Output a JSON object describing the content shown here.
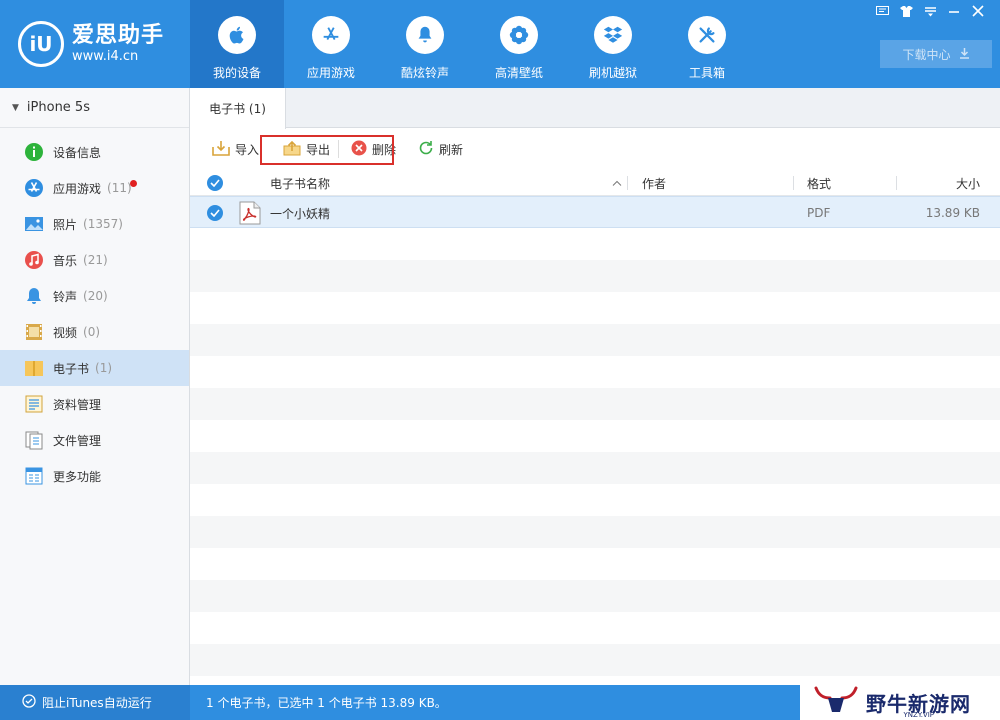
{
  "app": {
    "logo_main": "爱思助手",
    "logo_url": "www.i4.cn",
    "logo_mark": "iU"
  },
  "nav": [
    {
      "label": "我的设备",
      "icon": "apple-icon",
      "active": true
    },
    {
      "label": "应用游戏",
      "icon": "app-store-icon"
    },
    {
      "label": "酷炫铃声",
      "icon": "bell-icon"
    },
    {
      "label": "高清壁纸",
      "icon": "flower-icon"
    },
    {
      "label": "刷机越狱",
      "icon": "dropbox-icon"
    },
    {
      "label": "工具箱",
      "icon": "tools-icon"
    }
  ],
  "window_controls": [
    "feedback-icon",
    "skin-icon",
    "menu-icon",
    "minimize-icon",
    "close-icon"
  ],
  "download_center": "下载中心",
  "device": {
    "name": "iPhone 5s"
  },
  "sidebar": [
    {
      "label": "设备信息",
      "count": "",
      "icon": "info-icon"
    },
    {
      "label": "应用游戏",
      "count": "(11)",
      "icon": "app-icon",
      "badge": true
    },
    {
      "label": "照片",
      "count": "(1357)",
      "icon": "photo-icon"
    },
    {
      "label": "音乐",
      "count": "(21)",
      "icon": "music-icon"
    },
    {
      "label": "铃声",
      "count": "(20)",
      "icon": "ringtone-icon"
    },
    {
      "label": "视频",
      "count": "(0)",
      "icon": "video-icon"
    },
    {
      "label": "电子书",
      "count": "(1)",
      "icon": "ebook-icon",
      "active": true
    },
    {
      "label": "资料管理",
      "count": "",
      "icon": "data-icon"
    },
    {
      "label": "文件管理",
      "count": "",
      "icon": "file-icon"
    },
    {
      "label": "更多功能",
      "count": "",
      "icon": "more-icon"
    }
  ],
  "tab": {
    "label": "电子书 (1)"
  },
  "toolbar": {
    "import": "导入",
    "export": "导出",
    "delete": "删除",
    "refresh": "刷新"
  },
  "table": {
    "headers": {
      "name": "电子书名称",
      "author": "作者",
      "format": "格式",
      "size": "大小"
    },
    "rows": [
      {
        "name": "一个小妖精",
        "author": "",
        "format": "PDF",
        "size": "13.89 KB",
        "selected": true
      }
    ]
  },
  "status": {
    "itunes": "阻止iTunes自动运行",
    "summary": "1 个电子书，已选中 1 个电子书 13.89 KB。"
  },
  "watermark": {
    "text": "野牛新游网",
    "sub": "YNZY.VIP"
  },
  "colors": {
    "brand": "#2f8ee0",
    "highlight_border": "#d9302b"
  }
}
